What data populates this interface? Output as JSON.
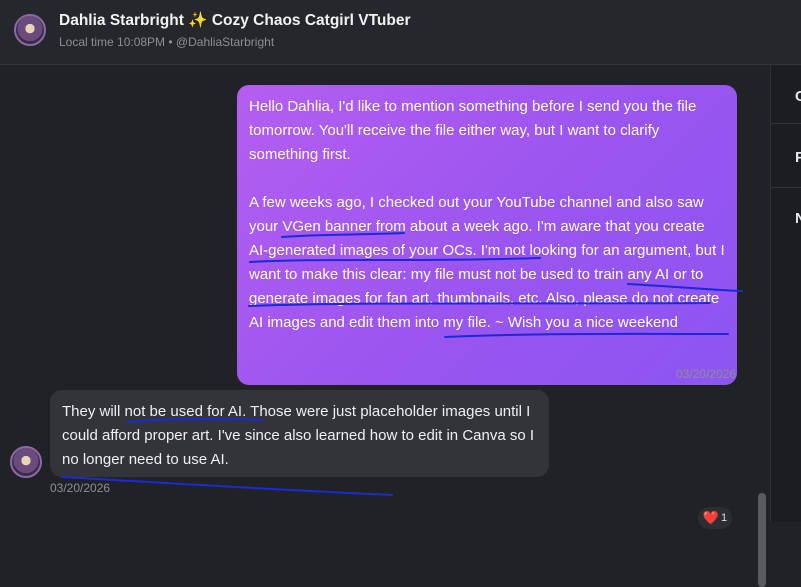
{
  "header": {
    "name": "Dahlia Starbright",
    "sparkle": "✨",
    "tagline": "Cozy Chaos Catgirl VTuber",
    "subtitle": "Local time 10:08PM • @DahliaStarbright"
  },
  "messages": {
    "outgoing": {
      "paragraph1": "Hello Dahlia, I'd like to mention something before I send you the file tomorrow. You'll receive the file either way, but I want to clarify something first.",
      "paragraph2": "A few weeks ago, I checked out your YouTube channel and also saw your VGen banner from about a week ago. I'm aware that you create AI-generated images of your OCs. I'm not looking for an argument, but I want to make this clear: my file must not be used to train any AI or to generate images for fan art, thumbnails, etc. Also, please do not create AI images and edit them into my file. ~ Wish you a nice weekend",
      "timestamp": "03/20/2026"
    },
    "incoming": {
      "text": "They will not be used for AI. Those were just placeholder images until I could afford proper art. I've since also learned how to edit in Canva so I no longer need to use AI.",
      "timestamp": "03/20/2026"
    }
  },
  "reaction": {
    "emoji": "❤️",
    "count": "1"
  },
  "side_panel": {
    "items": [
      "C",
      "P",
      "N"
    ]
  }
}
